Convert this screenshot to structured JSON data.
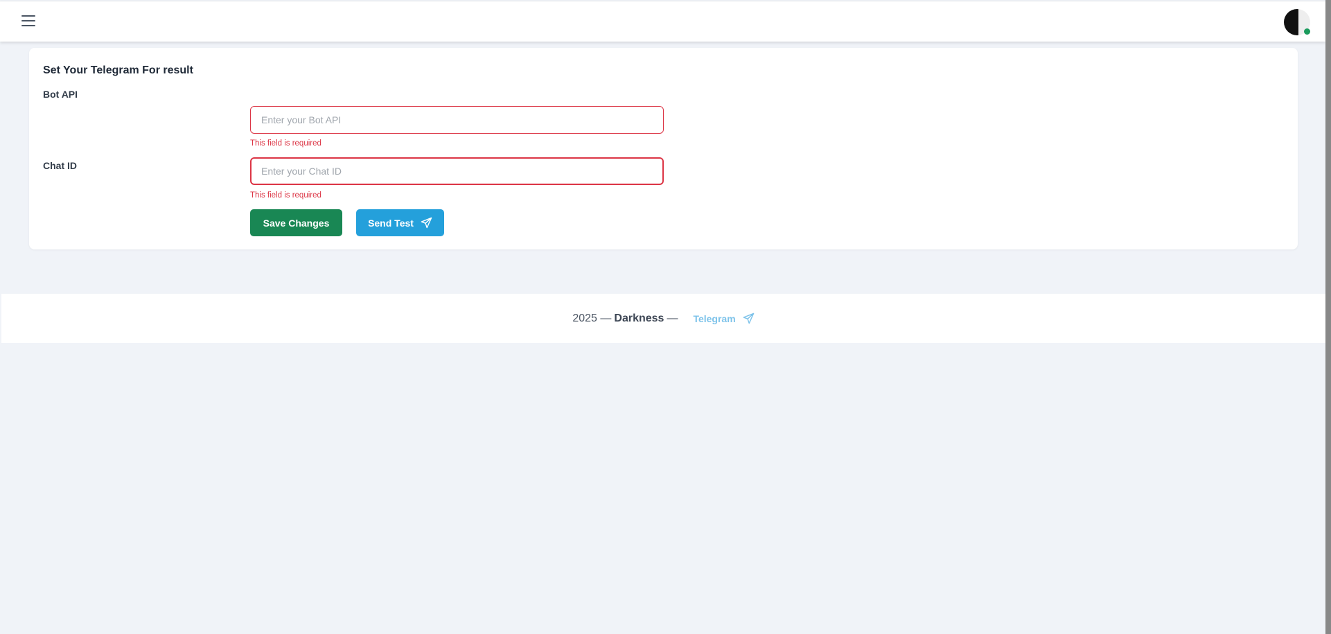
{
  "header": {
    "menu_icon": "hamburger-icon",
    "avatar_status_color": "#1a9b5c"
  },
  "card": {
    "title": "Set Your Telegram For result",
    "fields": [
      {
        "label": "Bot API",
        "placeholder": "Enter your Bot API",
        "value": "",
        "error": "This field is required"
      },
      {
        "label": "Chat ID",
        "placeholder": "Enter your Chat ID",
        "value": "",
        "error": "This field is required"
      }
    ],
    "save_label": "Save Changes",
    "send_label": "Send Test",
    "send_icon": "paper-plane-icon"
  },
  "footer": {
    "year": "2025 —",
    "brand": "Darkness",
    "sep": "—",
    "link": "Telegram",
    "link_icon": "paper-plane-icon"
  },
  "colors": {
    "success": "#198754",
    "info": "#24a0db",
    "danger": "#dc3545"
  }
}
